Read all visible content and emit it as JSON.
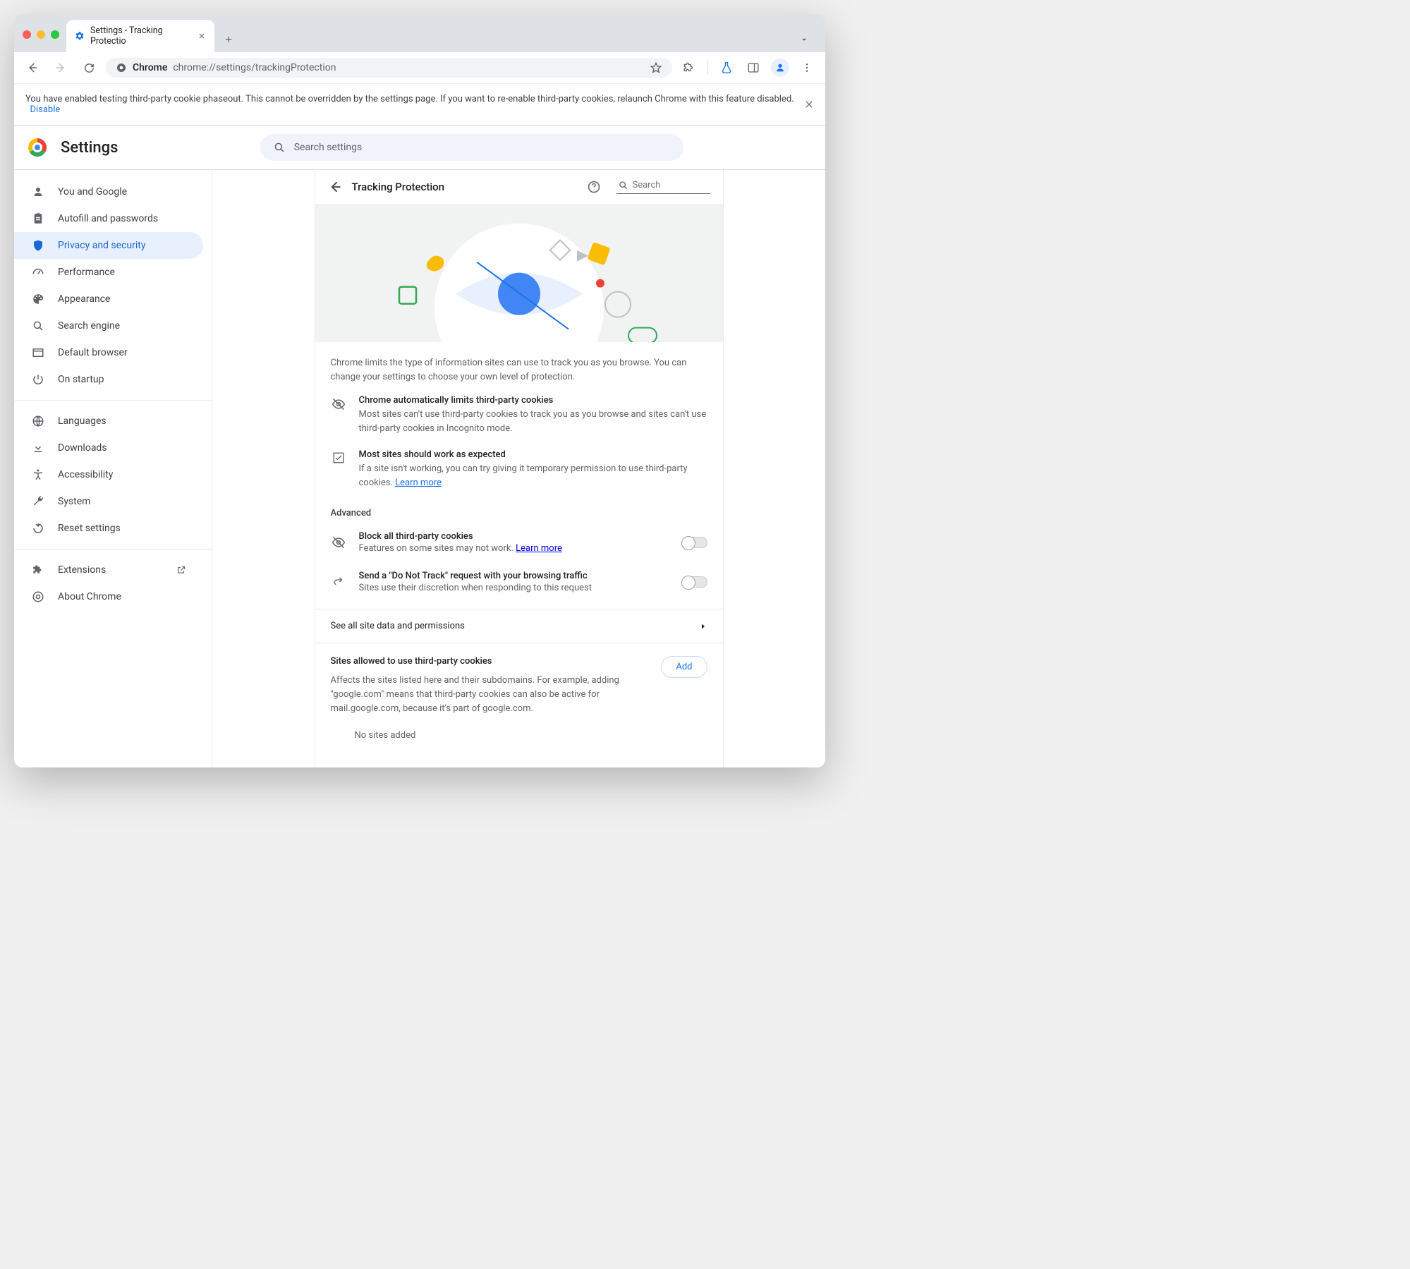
{
  "browser": {
    "tab_title": "Settings - Tracking Protectio",
    "omnibox_host": "Chrome",
    "omnibox_path": "chrome://settings/trackingProtection"
  },
  "notice": {
    "text": "You have enabled testing third-party cookie phaseout. This cannot be overridden by the settings page. If you want to re-enable third-party cookies, relaunch Chrome with this feature disabled.",
    "disable": "Disable"
  },
  "app": {
    "title": "Settings",
    "search_placeholder": "Search settings"
  },
  "sidebar": {
    "items": [
      {
        "label": "You and Google"
      },
      {
        "label": "Autofill and passwords"
      },
      {
        "label": "Privacy and security"
      },
      {
        "label": "Performance"
      },
      {
        "label": "Appearance"
      },
      {
        "label": "Search engine"
      },
      {
        "label": "Default browser"
      },
      {
        "label": "On startup"
      }
    ],
    "items2": [
      {
        "label": "Languages"
      },
      {
        "label": "Downloads"
      },
      {
        "label": "Accessibility"
      },
      {
        "label": "System"
      },
      {
        "label": "Reset settings"
      }
    ],
    "items3": [
      {
        "label": "Extensions"
      },
      {
        "label": "About Chrome"
      }
    ]
  },
  "page": {
    "title": "Tracking Protection",
    "search_placeholder": "Search",
    "intro": "Chrome limits the type of information sites can use to track you as you browse. You can change your settings to choose your own level of protection.",
    "info1_title": "Chrome automatically limits third-party cookies",
    "info1_body": "Most sites can't use third-party cookies to track you as you browse and sites can't use third-party cookies in Incognito mode.",
    "info2_title": "Most sites should work as expected",
    "info2_body": "If a site isn't working, you can try giving it temporary permission to use third-party cookies.",
    "learn_more": "Learn more",
    "advanced": "Advanced",
    "block_title": "Block all third-party cookies",
    "block_body": "Features on some sites may not work. ",
    "dnt_title": "Send a \"Do Not Track\" request with your browsing traffic",
    "dnt_body": "Sites use their discretion when responding to this request",
    "see_all": "See all site data and permissions",
    "allowed_title": "Sites allowed to use third-party cookies",
    "allowed_body": "Affects the sites listed here and their subdomains. For example, adding \"google.com\" means that third-party cookies can also be active for mail.google.com, because it's part of google.com.",
    "add": "Add",
    "no_sites": "No sites added"
  }
}
